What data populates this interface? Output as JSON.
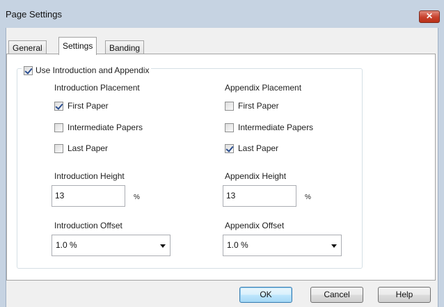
{
  "window": {
    "title": "Page Settings",
    "close_glyph": "✕"
  },
  "tabs": [
    {
      "label": "General",
      "active": false
    },
    {
      "label": "Settings",
      "active": true
    },
    {
      "label": "Banding",
      "active": false
    }
  ],
  "use_intro_appendix": {
    "label": "Use Introduction and Appendix",
    "checked": true
  },
  "introduction": {
    "placement_heading": "Introduction Placement",
    "placements": [
      {
        "label": "First Paper",
        "checked": true
      },
      {
        "label": "Intermediate Papers",
        "checked": false
      },
      {
        "label": "Last Paper",
        "checked": false
      }
    ],
    "height_label": "Introduction Height",
    "height_value": "13",
    "height_unit": "%",
    "offset_label": "Introduction Offset",
    "offset_value": "1.0 %"
  },
  "appendix": {
    "placement_heading": "Appendix Placement",
    "placements": [
      {
        "label": "First Paper",
        "checked": false
      },
      {
        "label": "Intermediate Papers",
        "checked": false
      },
      {
        "label": "Last Paper",
        "checked": true
      }
    ],
    "height_label": "Appendix Height",
    "height_value": "13",
    "height_unit": "%",
    "offset_label": "Appendix Offset",
    "offset_value": "1.0 %"
  },
  "buttons": {
    "ok": "OK",
    "cancel": "Cancel",
    "help": "Help"
  }
}
